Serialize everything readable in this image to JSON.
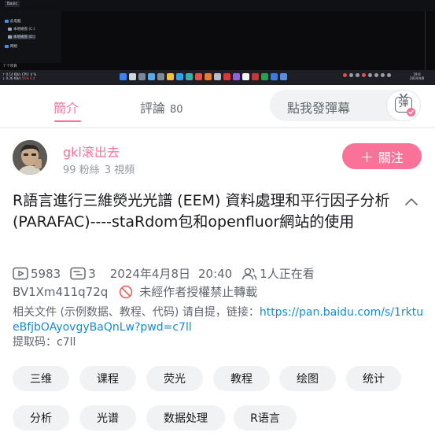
{
  "video": {
    "explorer_label": "Basic",
    "tree_items": [
      {
        "label": "此电脑",
        "color": "#4a90d9"
      },
      {
        "label": "本地磁盘 (C:)",
        "color": "#9aa6b2"
      },
      {
        "label": "本地磁盘 (D:)",
        "color": "#9aa6b2"
      },
      {
        "label": "网络",
        "color": "#4a90d9"
      }
    ],
    "status_text": "7 个项目",
    "taskbar": {
      "line1": "↑ 0.14 KB/s   CPU: 4 %",
      "line2": "↓ 0.26 KB/s",
      "mem": "55% 4.4",
      "clock_time": "19:0",
      "clock_date": "2024/4/8"
    }
  },
  "tabs": {
    "intro": "簡介",
    "comments": "評論",
    "comments_count": "80",
    "danmaku_placeholder": "點我發彈幕",
    "danmaku_icon_char": "弹"
  },
  "uploader": {
    "name": "gkl滚出去",
    "fans": "99 粉絲",
    "videos": "3 視頻",
    "follow_label": "關注"
  },
  "title": "R語言進行三維熒光光譜 (EEM) 資料處理和平行因子分析 (PARAFAC)----staRdom包和openfluor網站的使用",
  "meta": {
    "views": "5983",
    "danmaku": "3",
    "date": "2024年4月8日",
    "time": "20:40",
    "watching": "1人正在看",
    "bvid": "BV1Xm411q72q",
    "copyright": "未經作者授權禁止轉載"
  },
  "description": {
    "text_before_link": "相关文件 (示例数据、教程、代码) 请自提，链接：",
    "link": "https://pan.baidu.com/s/1rktueBfjbOAyovgyBaQnLw?pwd=c7ll",
    "extract_code": "提取码：c7ll"
  },
  "tags": [
    "三维",
    "课程",
    "荧光",
    "教程",
    "绘图",
    "统计",
    "分析",
    "光谱",
    "数据处理",
    "R语言"
  ],
  "colors": {
    "accent": "#fb7299",
    "link": "#178bcf",
    "muted": "#61666d",
    "tag_bg": "#f1f2f3"
  }
}
